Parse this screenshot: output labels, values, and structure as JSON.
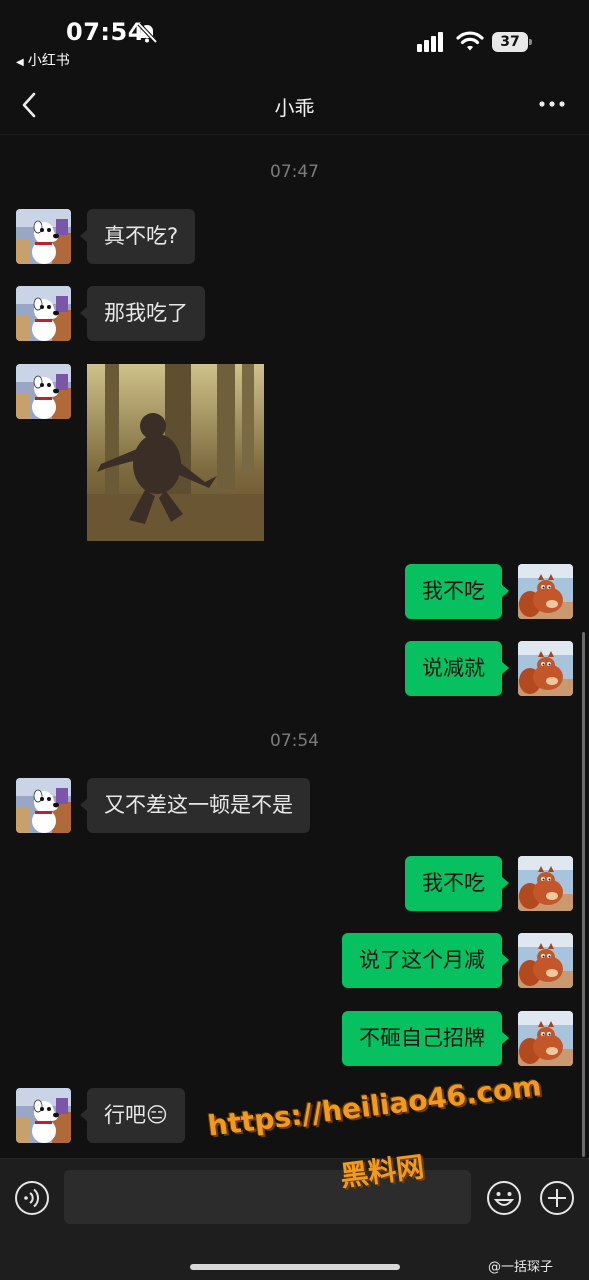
{
  "status_bar": {
    "time": "07:54",
    "back_app": "小红书",
    "battery": "37",
    "icons": [
      "bell-slash-icon",
      "signal-icon",
      "wifi-icon",
      "battery-icon"
    ]
  },
  "nav": {
    "title": "小乖",
    "icons": [
      "chevron-left-icon",
      "more-icon"
    ]
  },
  "timestamps": [
    "07:47",
    "07:54"
  ],
  "messages": [
    {
      "side": "left",
      "type": "text",
      "text": "真不吃?"
    },
    {
      "side": "left",
      "type": "text",
      "text": "那我吃了"
    },
    {
      "side": "left",
      "type": "image",
      "image_name": "gorilla-dance-image"
    },
    {
      "side": "right",
      "type": "text",
      "text": "我不吃"
    },
    {
      "side": "right",
      "type": "text",
      "text": "说减就"
    },
    {
      "side": "left",
      "type": "text",
      "text": "又不差这一顿是不是"
    },
    {
      "side": "right",
      "type": "text",
      "text": "我不吃"
    },
    {
      "side": "right",
      "type": "text",
      "text": "说了这个月减"
    },
    {
      "side": "right",
      "type": "text",
      "text": "不砸自己招牌"
    },
    {
      "side": "left",
      "type": "text",
      "text": "行吧😑"
    }
  ],
  "input_bar": {
    "value": "",
    "icons": [
      "voice-icon",
      "emoji-icon",
      "plus-icon"
    ]
  },
  "watermark": {
    "url": "https://heiliao46.com",
    "name": "黑料网",
    "weibo": "@一括琛子"
  },
  "colors": {
    "background": "#111111",
    "bubble_left": "#2c2c2c",
    "bubble_right": "#07c160",
    "watermark": "#f39a1c"
  }
}
